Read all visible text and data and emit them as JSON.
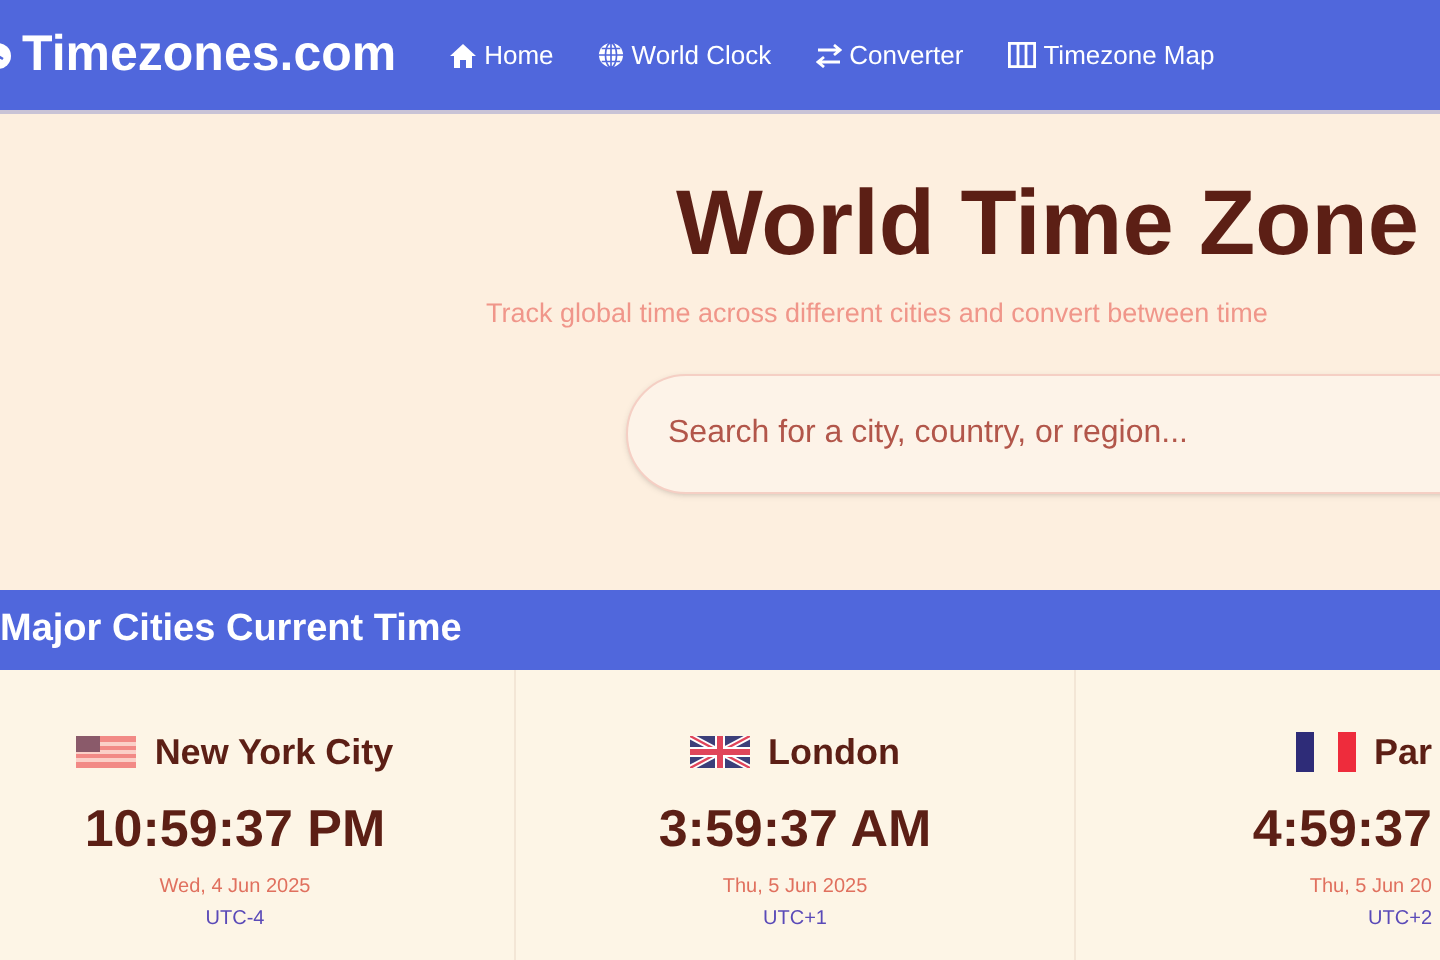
{
  "navbar": {
    "logo": "Timezones.com",
    "links": [
      {
        "label": "Home"
      },
      {
        "label": "World Clock"
      },
      {
        "label": "Converter"
      },
      {
        "label": "Timezone Map"
      }
    ]
  },
  "hero": {
    "title": "World Time Zone",
    "subtitle": "Track global time across different cities and convert between time",
    "search": {
      "placeholder": "Search for a city, country, or region..."
    }
  },
  "section": {
    "title": "Major Cities Current Time"
  },
  "cities": [
    {
      "name": "New York City",
      "time": "10:59:37 PM",
      "date": "Wed, 4 Jun 2025",
      "offset": "UTC-4"
    },
    {
      "name": "London",
      "time": "3:59:37 AM",
      "date": "Thu, 5 Jun 2025",
      "offset": "UTC+1"
    },
    {
      "name": "Par",
      "time": "4:59:37",
      "date": "Thu, 5 Jun 20",
      "offset": "UTC+2"
    }
  ]
}
